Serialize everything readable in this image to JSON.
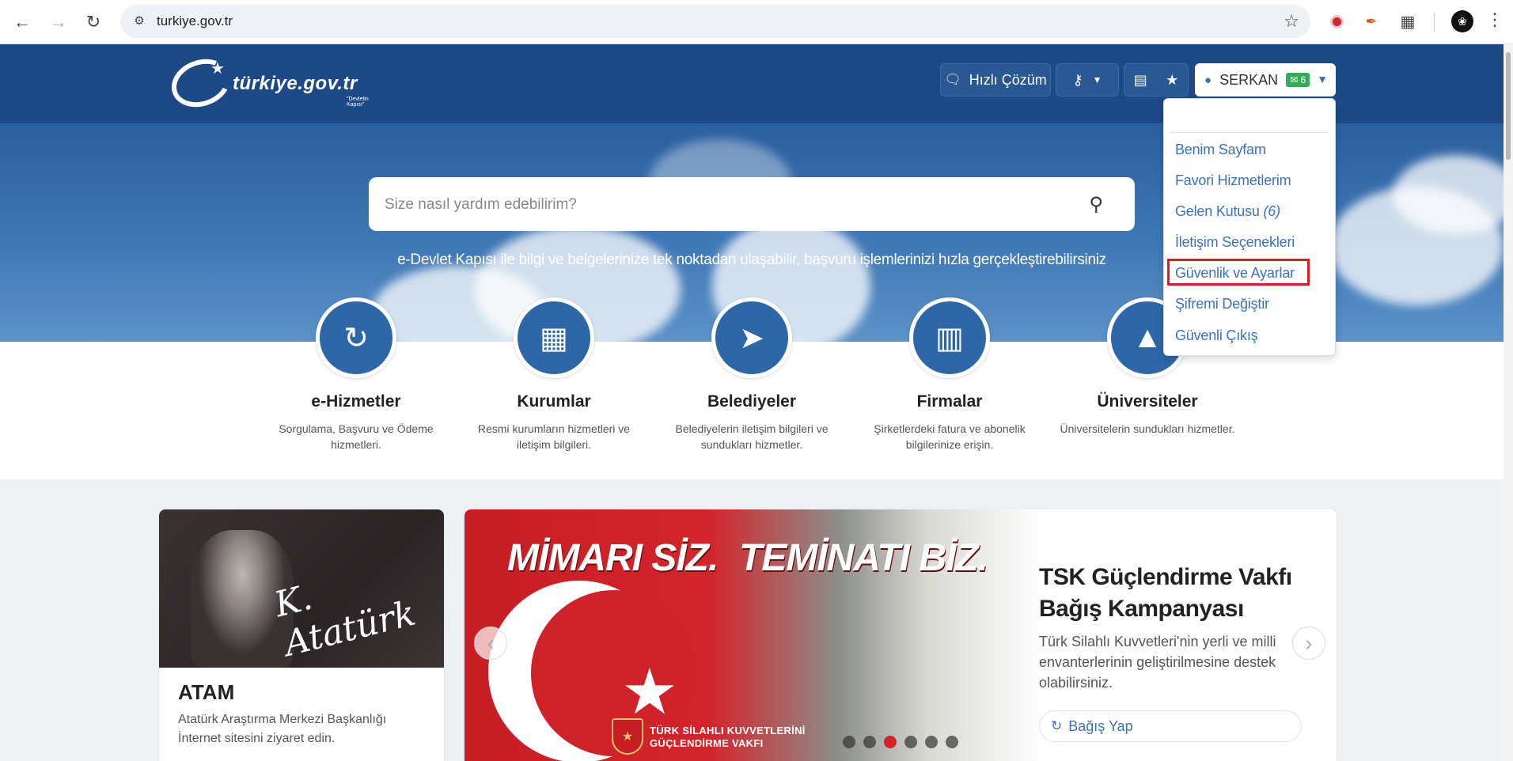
{
  "browser": {
    "url": "turkiye.gov.tr",
    "icons": [
      "back-arrow-icon",
      "forward-arrow-icon",
      "reload-icon",
      "site-settings-icon",
      "bookmark-star-icon",
      "extension-red-icon",
      "extension-brush-icon",
      "extensions-puzzle-icon",
      "profile-avatar-icon",
      "menu-kebab-icon"
    ]
  },
  "header": {
    "logo_text": "türkiye.gov.tr",
    "logo_tagline": "\"Devletin Kapısı\"",
    "quick_solution_label": "Hızlı Çözüm",
    "user": {
      "name": "SERKAN",
      "message_count": "6"
    }
  },
  "search": {
    "placeholder": "Size nasıl yardım edebilirim?"
  },
  "hero_subtitle": "e-Devlet Kapısı ile bilgi ve belgelerinize tek noktadan ulaşabilir, başvuru işlemlerinizi hızla gerçekleştirebilirsiniz",
  "categories": [
    {
      "title": "e-Hizmetler",
      "desc": "Sorgulama, Başvuru ve Ödeme hizmetleri.",
      "icon": "refresh-icon"
    },
    {
      "title": "Kurumlar",
      "desc": "Resmi kurumların hizmetleri ve iletişim bilgileri.",
      "icon": "building-icon"
    },
    {
      "title": "Belediyeler",
      "desc": "Belediyelerin iletişim bilgileri ve sundukları hizmetler.",
      "icon": "signpost-icon"
    },
    {
      "title": "Firmalar",
      "desc": "Şirketlerdeki fatura ve abonelik bilgilerinize erişin.",
      "icon": "factory-icon"
    },
    {
      "title": "Üniversiteler",
      "desc": "Üniversitelerin sundukları hizmetler.",
      "icon": "graduation-cap-icon"
    }
  ],
  "user_menu": {
    "items": [
      {
        "label": "Benim Sayfam"
      },
      {
        "label": "Favori Hizmetlerim"
      },
      {
        "label": "Gelen Kutusu",
        "count": "(6)"
      },
      {
        "label": "İletişim Seçenekleri"
      },
      {
        "label": "Güvenlik ve Ayarlar",
        "highlighted": true
      },
      {
        "label": "Şifremi Değiştir"
      },
      {
        "label": "Güvenli Çıkış"
      }
    ],
    "highlight_color": "#e01a22"
  },
  "atam_card": {
    "title": "ATAM",
    "description": "Atatürk Araştırma Merkezi Başkanlığı İnternet sitesini ziyaret edin.",
    "signature": "K. Atatürk"
  },
  "campaign": {
    "banner_slogan_1": "MİMARI SİZ.",
    "banner_slogan_2": "TEMİNATI BİZ.",
    "banner_org_line_1": "TÜRK SİLAHLI KUVVETLERİNİ",
    "banner_org_line_2": "GÜÇLENDİRME VAKFI",
    "title": "TSK Güçlendirme Vakfı Bağış Kampanyası",
    "description": "Türk Silahlı Kuvvetleri'nin yerli ve milli envanterlerinin geliştirilmesine destek olabilirsiniz.",
    "button_label": "Bağış Yap",
    "slide_count": 6,
    "active_slide": 3
  },
  "colors": {
    "header_blue": "#1d4a86",
    "accent_blue": "#3b73b9",
    "badge_green": "#2fae57",
    "flag_red": "#c71d24"
  }
}
